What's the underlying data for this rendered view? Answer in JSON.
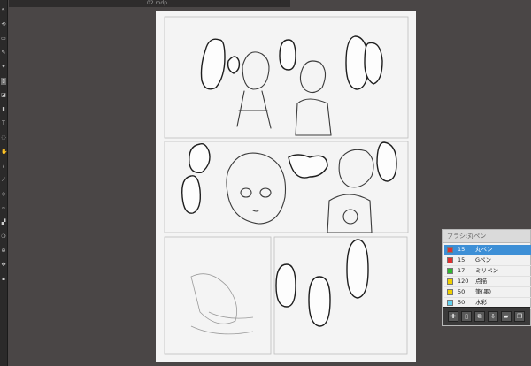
{
  "window": {
    "title": "02.mdp"
  },
  "toolbar": {
    "tools": [
      {
        "name": "select-tool",
        "glyph": "↖"
      },
      {
        "name": "rotate-tool",
        "glyph": "⟲"
      },
      {
        "name": "rect-select-tool",
        "glyph": "▭"
      },
      {
        "name": "pen-tool",
        "glyph": "✎"
      },
      {
        "name": "brush-tool",
        "glyph": "✦"
      },
      {
        "name": "layer-tool",
        "glyph": "▯"
      },
      {
        "name": "eraser-tool",
        "glyph": "◪"
      },
      {
        "name": "fill-tool",
        "glyph": "▮"
      },
      {
        "name": "text-tool",
        "glyph": "T"
      },
      {
        "name": "lasso-tool",
        "glyph": "◌"
      },
      {
        "name": "hand-tool",
        "glyph": "✋"
      },
      {
        "name": "line-tool",
        "glyph": "/"
      },
      {
        "name": "eyedrop-tool",
        "glyph": "⟋"
      },
      {
        "name": "shape-tool",
        "glyph": "◇"
      },
      {
        "name": "curve-tool",
        "glyph": "~"
      },
      {
        "name": "gradient-tool",
        "glyph": "▞"
      },
      {
        "name": "blur-tool",
        "glyph": "❍"
      },
      {
        "name": "zoom-tool",
        "glyph": "⊕"
      },
      {
        "name": "move-tool",
        "glyph": "✥"
      },
      {
        "name": "stamp-tool",
        "glyph": "▪"
      }
    ]
  },
  "brush_panel": {
    "title": "ブラシ:丸ペン",
    "brushes": [
      {
        "size": "15",
        "name": "丸ペン",
        "color": "#e03030",
        "selected": true
      },
      {
        "size": "15",
        "name": "Gペン",
        "color": "#e03030",
        "selected": false
      },
      {
        "size": "17",
        "name": "ミリペン",
        "color": "#2fb82f",
        "selected": false
      },
      {
        "size": "120",
        "name": "点描",
        "color": "#f0d000",
        "selected": false
      },
      {
        "size": "50",
        "name": "筆(墨)",
        "color": "#f0d000",
        "selected": false
      },
      {
        "size": "50",
        "name": "水彩",
        "color": "#60d0f0",
        "selected": false
      }
    ],
    "footer_buttons": [
      {
        "name": "brush-add-icon",
        "glyph": "✚"
      },
      {
        "name": "new-brush-icon",
        "glyph": "▯"
      },
      {
        "name": "brush-copy-icon",
        "glyph": "⧉"
      },
      {
        "name": "brush-export-icon",
        "glyph": "⇩"
      },
      {
        "name": "folder-icon",
        "glyph": "▰"
      },
      {
        "name": "duplicate-icon",
        "glyph": "❐"
      }
    ]
  }
}
